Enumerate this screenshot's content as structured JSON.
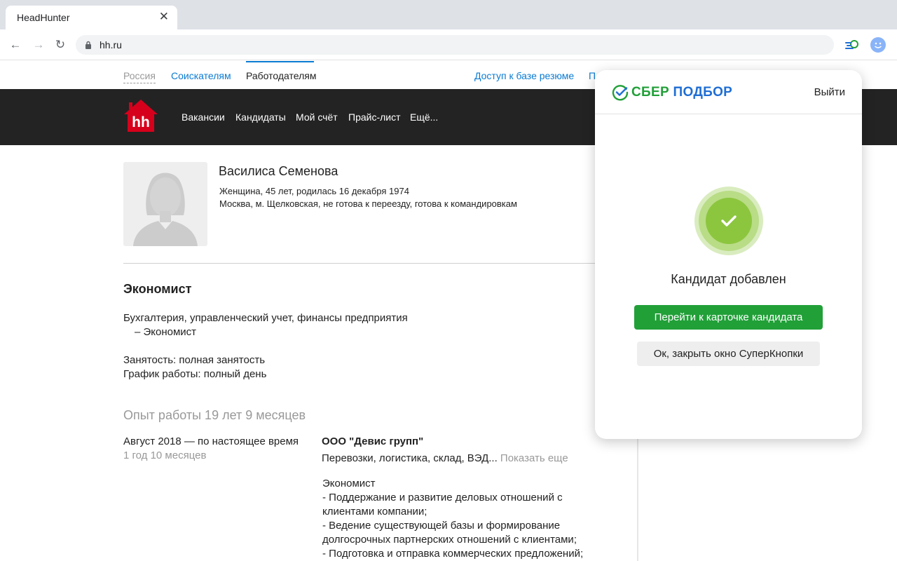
{
  "browser": {
    "tab_title": "HeadHunter",
    "tab_close": "✕",
    "url": "hh.ru",
    "back": "←",
    "forward": "→",
    "reload": "↻"
  },
  "topnav": {
    "country": "Россия",
    "seekers": "Соискателям",
    "employers": "Работодателям",
    "resume_access": "Доступ к базе резюме",
    "truncated": "П"
  },
  "header": {
    "logo_text": "hh",
    "menu": [
      "Вакансии",
      "Кандидаты",
      "Мой счёт",
      "Прайс-лист",
      "Ещё..."
    ]
  },
  "candidate": {
    "name": "Василиса Семенова",
    "info_line1": "Женщина, 45 лет, родилась 16 декабря 1974",
    "info_line2": "Москва, м. Щелковская, не готова к переезду, готова к командировкам",
    "position": "Экономист",
    "spec_line1": "Бухгалтерия, управленческий учет, финансы предприятия",
    "spec_line2": "– Экономист",
    "employment": "Занятость: полная занятость",
    "schedule": "График работы: полный день"
  },
  "experience": {
    "title": "Опыт работы 19 лет 9 месяцев",
    "period": "Август 2018 — по настоящее время",
    "duration": "1 год 10 месяцев",
    "company": "ООО \"Девис групп\"",
    "industry": "Перевозки, логистика, склад, ВЭД...",
    "show_more": "Показать еще",
    "role": "Экономист",
    "desc": [
      "- Поддержание и развитие деловых отношений с",
      "клиентами компании;",
      "- Ведение существующей базы и формирование",
      "долгосрочных партнерских отношений с клиентами;",
      "- Подготовка и отправка коммерческих предложений;"
    ]
  },
  "popup": {
    "brand_part1": "СБЕР",
    "brand_part2": "ПОДБОР",
    "logout": "Выйти",
    "status": "Кандидат добавлен",
    "primary_button": "Перейти к карточке кандидата",
    "secondary_button": "Ок, закрыть окно СуперКнопки"
  },
  "colors": {
    "hh_red": "#d6001c",
    "hh_blue": "#0a7bd3",
    "sber_green": "#21a038",
    "sber_blue": "#1f6ed4",
    "success_green": "#8cc63f"
  }
}
